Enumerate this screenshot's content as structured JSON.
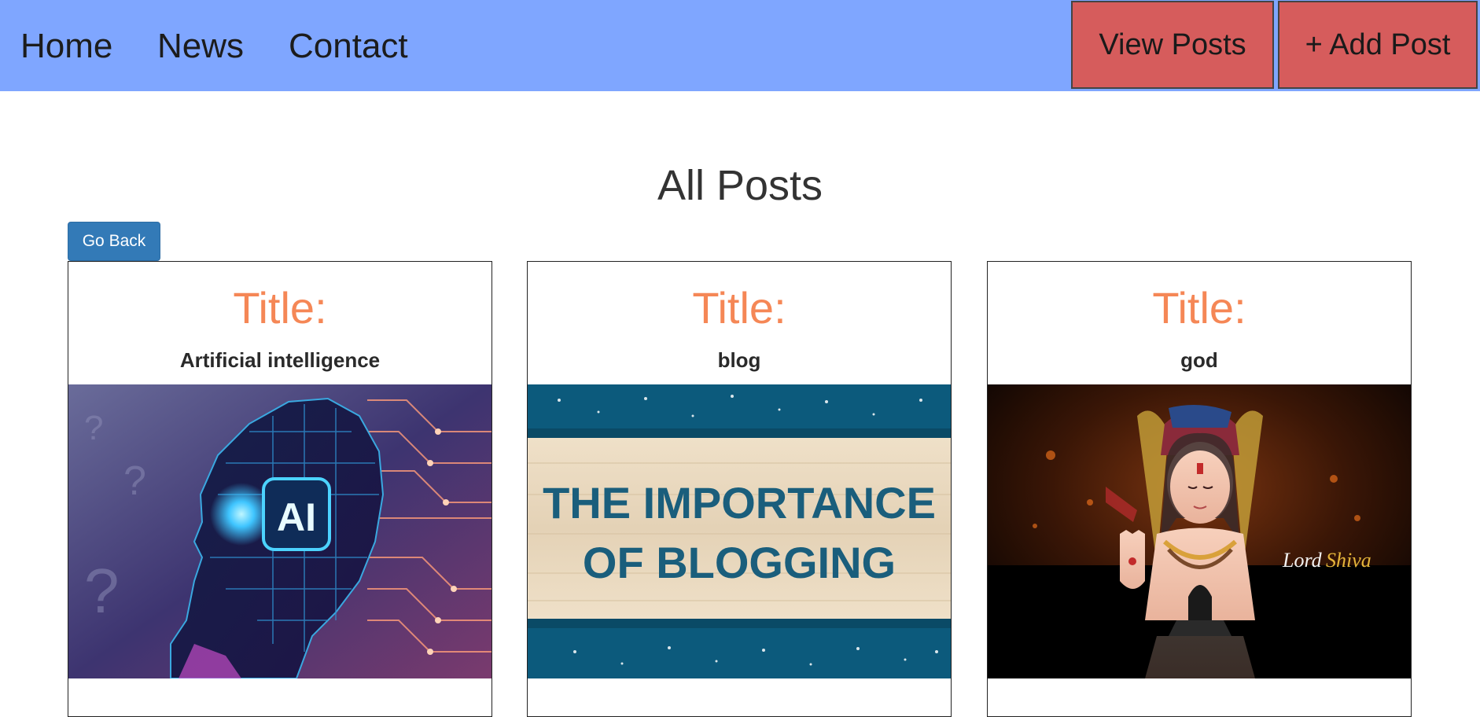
{
  "nav": {
    "links": [
      "Home",
      "News",
      "Contact"
    ],
    "view_posts_label": "View Posts",
    "add_post_label": "+ Add Post"
  },
  "page": {
    "title": "All Posts",
    "go_back_label": "Go Back"
  },
  "cards": [
    {
      "title_label": "Title:",
      "title": "Artificial intelligence",
      "image": {
        "badge_text": "AI"
      }
    },
    {
      "title_label": "Title:",
      "title": "blog",
      "image": {
        "line1": "THE IMPORTANCE",
        "line2": "OF BLOGGING"
      }
    },
    {
      "title_label": "Title:",
      "title": "god",
      "image": {
        "caption_first": "Lord",
        "caption_second": "Shiva"
      }
    }
  ],
  "colors": {
    "navbar": "#7fa6ff",
    "nav_button": "#d65c5c",
    "go_back_button": "#337ab7",
    "title_label": "#f58756"
  }
}
